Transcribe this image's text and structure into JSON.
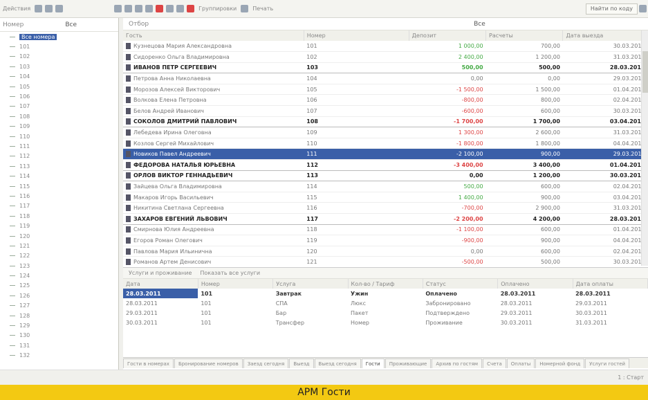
{
  "toolbar": {
    "left_label": "Действия",
    "groups_button": "Группировки",
    "print_button": "Печать",
    "right_button": "Найти по коду"
  },
  "left_panel": {
    "header_label": "Номер",
    "header_value": "Все",
    "items": [
      {
        "label": "Все номера",
        "selected": true
      },
      {
        "label": "101"
      },
      {
        "label": "102"
      },
      {
        "label": "103"
      },
      {
        "label": "104"
      },
      {
        "label": "105"
      },
      {
        "label": "106"
      },
      {
        "label": "107"
      },
      {
        "label": "108"
      },
      {
        "label": "109"
      },
      {
        "label": "110"
      },
      {
        "label": "111"
      },
      {
        "label": "112"
      },
      {
        "label": "113"
      },
      {
        "label": "114"
      },
      {
        "label": "115"
      },
      {
        "label": "116"
      },
      {
        "label": "117"
      },
      {
        "label": "118"
      },
      {
        "label": "119"
      },
      {
        "label": "120"
      },
      {
        "label": "121"
      },
      {
        "label": "122"
      },
      {
        "label": "123"
      },
      {
        "label": "124"
      },
      {
        "label": "125"
      },
      {
        "label": "126"
      },
      {
        "label": "127"
      },
      {
        "label": "128"
      },
      {
        "label": "129"
      },
      {
        "label": "130"
      },
      {
        "label": "131"
      },
      {
        "label": "132"
      }
    ]
  },
  "filter": {
    "label": "Отбор",
    "value": "Все"
  },
  "grid": {
    "columns": [
      "Гость",
      "Номер",
      "Депозит",
      "Расчеты",
      "Дата выезда"
    ],
    "rows": [
      {
        "name": "Кузнецова Мария Александровна",
        "room": "101",
        "deposit": "1 000,00",
        "dtone": "g",
        "pay": "700,00",
        "date": "30.03.2011"
      },
      {
        "name": "Сидоренко Ольга Владимировна",
        "room": "102",
        "deposit": "2 400,00",
        "dtone": "g",
        "pay": "1 200,00",
        "date": "31.03.2011"
      },
      {
        "name": "ИВАНОВ ПЕТР СЕРГЕЕВИЧ",
        "room": "103",
        "deposit": "500,00",
        "dtone": "g",
        "pay": "500,00",
        "date": "28.03.2011",
        "bold": true
      },
      {
        "name": "Петрова Анна Николаевна",
        "room": "104",
        "deposit": "0,00",
        "dtone": "",
        "pay": "0,00",
        "date": "29.03.2011"
      },
      {
        "name": "Морозов Алексей Викторович",
        "room": "105",
        "deposit": "-1 500,00",
        "dtone": "r",
        "pay": "1 500,00",
        "date": "01.04.2011"
      },
      {
        "name": "Волкова Елена Петровна",
        "room": "106",
        "deposit": "-800,00",
        "dtone": "r",
        "pay": "800,00",
        "date": "02.04.2011"
      },
      {
        "name": "Белов Андрей Иванович",
        "room": "107",
        "deposit": "-600,00",
        "dtone": "r",
        "pay": "600,00",
        "date": "30.03.2011"
      },
      {
        "name": "СОКОЛОВ ДМИТРИЙ ПАВЛОВИЧ",
        "room": "108",
        "deposit": "-1 700,00",
        "dtone": "r",
        "pay": "1 700,00",
        "date": "03.04.2011",
        "bold": true
      },
      {
        "name": "Лебедева Ирина Олеговна",
        "room": "109",
        "deposit": "1 300,00",
        "dtone": "r",
        "pay": "2 600,00",
        "date": "31.03.2011"
      },
      {
        "name": "Козлов Сергей Михайлович",
        "room": "110",
        "deposit": "-1 800,00",
        "dtone": "r",
        "pay": "1 800,00",
        "date": "04.04.2011"
      },
      {
        "name": "Новиков Павел Андреевич",
        "room": "111",
        "deposit": "-2 100,00",
        "dtone": "r",
        "pay": "900,00",
        "date": "29.03.2011",
        "selected": true
      },
      {
        "name": "ФЕДОРОВА НАТАЛЬЯ ЮРЬЕВНА",
        "room": "112",
        "deposit": "-3 400,00",
        "dtone": "r",
        "pay": "3 400,00",
        "date": "01.04.2011",
        "bold": true
      },
      {
        "name": "ОРЛОВ ВИКТОР ГЕННАДЬЕВИЧ",
        "room": "113",
        "deposit": "0,00",
        "dtone": "",
        "pay": "1 200,00",
        "date": "30.03.2011",
        "bold": true
      },
      {
        "name": "Зайцева Ольга Владимировна",
        "room": "114",
        "deposit": "500,00",
        "dtone": "g",
        "pay": "600,00",
        "date": "02.04.2011"
      },
      {
        "name": "Макаров Игорь Васильевич",
        "room": "115",
        "deposit": "1 400,00",
        "dtone": "g",
        "pay": "900,00",
        "date": "03.04.2011"
      },
      {
        "name": "Никитина Светлана Сергеевна",
        "room": "116",
        "deposit": "-700,00",
        "dtone": "r",
        "pay": "2 900,00",
        "date": "31.03.2011"
      },
      {
        "name": "ЗАХАРОВ ЕВГЕНИЙ ЛЬВОВИЧ",
        "room": "117",
        "deposit": "-2 200,00",
        "dtone": "r",
        "pay": "4 200,00",
        "date": "28.03.2011",
        "bold": true
      },
      {
        "name": "Смирнова Юлия Андреевна",
        "room": "118",
        "deposit": "-1 100,00",
        "dtone": "r",
        "pay": "600,00",
        "date": "01.04.2011"
      },
      {
        "name": "Егоров Роман Олегович",
        "room": "119",
        "deposit": "-900,00",
        "dtone": "r",
        "pay": "900,00",
        "date": "04.04.2011"
      },
      {
        "name": "Павлова Мария Ильинична",
        "room": "120",
        "deposit": "0,00",
        "dtone": "",
        "pay": "600,00",
        "date": "02.04.2011"
      },
      {
        "name": "Романов Артем Денисович",
        "room": "121",
        "deposit": "-500,00",
        "dtone": "r",
        "pay": "500,00",
        "date": "30.03.2011"
      }
    ]
  },
  "sub_panel": {
    "tabs_label": "Услуги и проживание",
    "link_label": "Показать все услуги",
    "columns": [
      "Дата",
      "Номер",
      "Услуга",
      "Кол-во / Тариф",
      "Статус",
      "Оплачено",
      "Дата оплаты"
    ],
    "rows": [
      [
        "28.03.2011",
        "101",
        "Завтрак",
        "Ужин",
        "Оплачено",
        "28.03.2011",
        "28.03.2011"
      ],
      [
        "28.03.2011",
        "101",
        "СПА",
        "Люкс",
        "Забронировано",
        "28.03.2011",
        "29.03.2011"
      ],
      [
        "29.03.2011",
        "101",
        "Бар",
        "Пакет",
        "Подтверждено",
        "29.03.2011",
        "30.03.2011"
      ],
      [
        "30.03.2011",
        "101",
        "Трансфер",
        "Номер",
        "Проживание",
        "30.03.2011",
        "31.03.2011"
      ]
    ]
  },
  "bottom_tabs": [
    "Гости в номерах",
    "Бронирование номеров",
    "Заезд сегодня",
    "Выезд",
    "Выезд сегодня",
    "Гости",
    "Проживающие",
    "Архив по гостям",
    "Счета",
    "Оплаты",
    "Номерной фонд",
    "Услуги гостей"
  ],
  "active_tab": 5,
  "status": {
    "text": "1 : Старт"
  },
  "caption": "АРМ Гости"
}
